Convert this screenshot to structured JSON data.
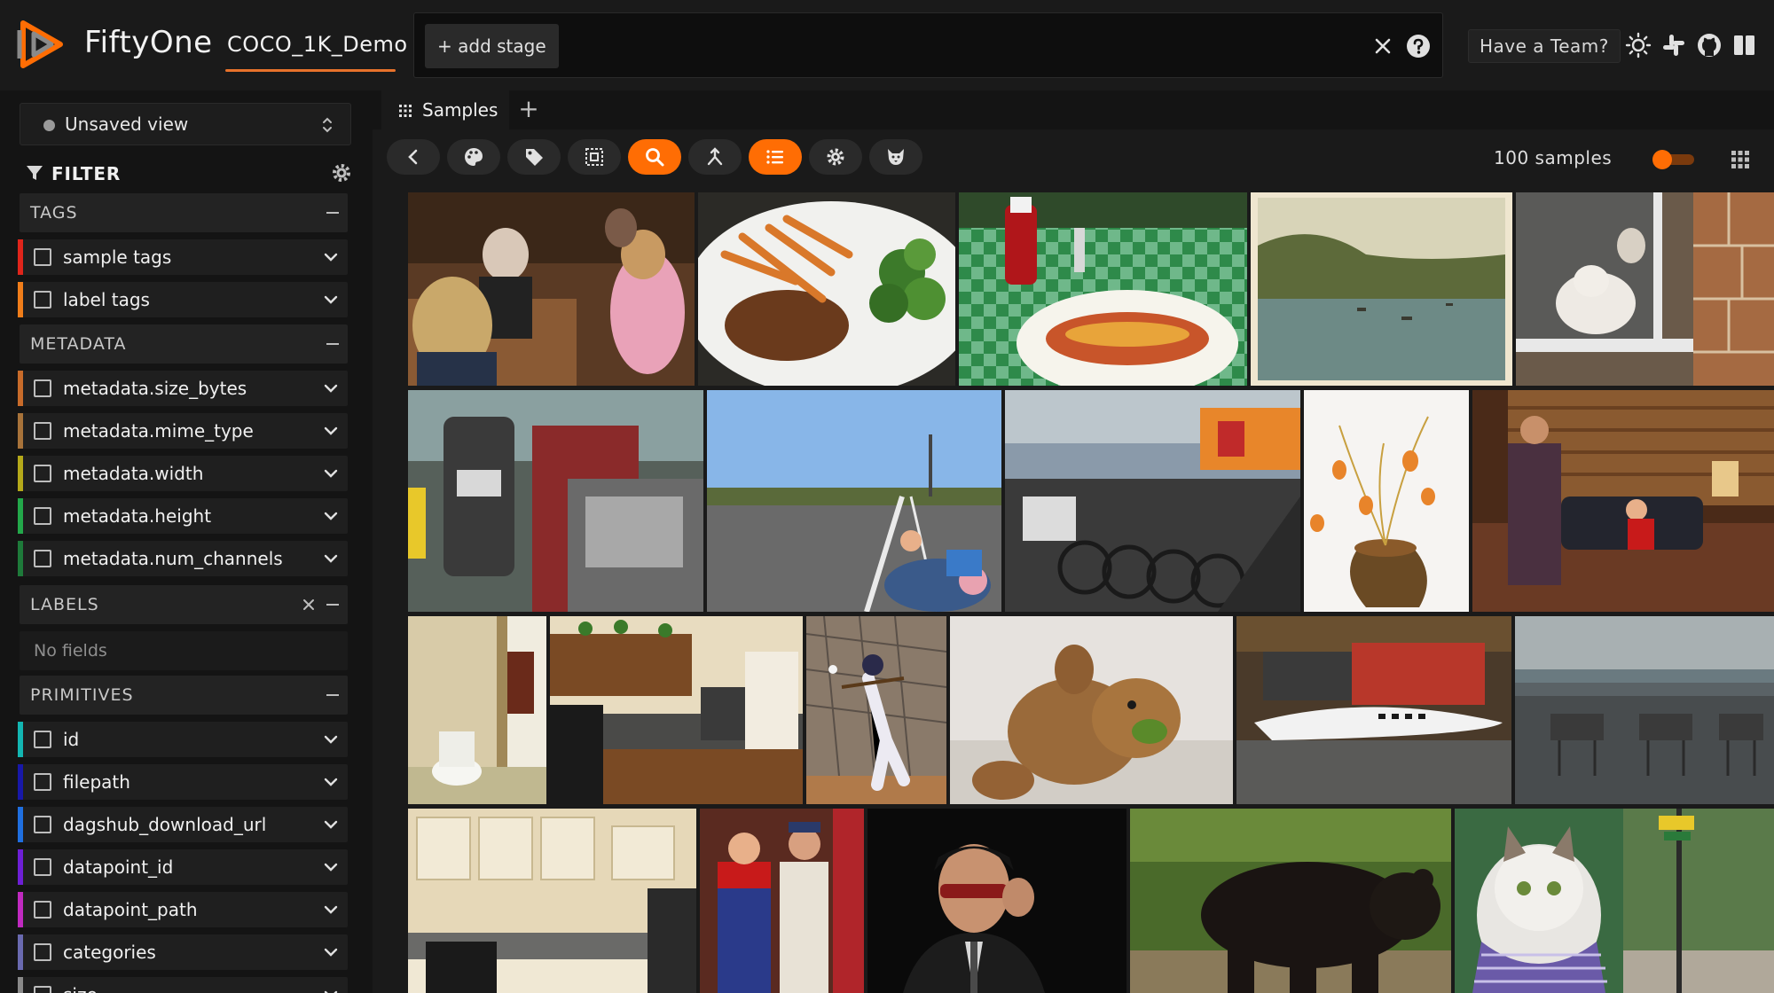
{
  "app": {
    "title": "FiftyOne",
    "dataset": "COCO_1K_Demo"
  },
  "viewbar": {
    "add_stage": "+ add stage"
  },
  "header": {
    "team_button": "Have a Team?",
    "icons": [
      "sun-icon",
      "slack-icon",
      "github-icon",
      "docs-book-icon"
    ]
  },
  "sidebar": {
    "view_selector": "Unsaved view",
    "filter_title": "FILTER",
    "sections": {
      "tags": {
        "title": "TAGS",
        "rows": [
          {
            "label": "sample tags",
            "color": "#e0251b"
          },
          {
            "label": "label tags",
            "color": "#f07d1a"
          }
        ]
      },
      "metadata": {
        "title": "METADATA",
        "rows": [
          {
            "label": "metadata.size_bytes",
            "color": "#c86b2a"
          },
          {
            "label": "metadata.mime_type",
            "color": "#a8733a"
          },
          {
            "label": "metadata.width",
            "color": "#b5a91a"
          },
          {
            "label": "metadata.height",
            "color": "#23a84a"
          },
          {
            "label": "metadata.num_channels",
            "color": "#1e7a3a"
          }
        ]
      },
      "labels": {
        "title": "LABELS",
        "empty": "No fields"
      },
      "primitives": {
        "title": "PRIMITIVES",
        "rows": [
          {
            "label": "id",
            "color": "#13b6b2"
          },
          {
            "label": "filepath",
            "color": "#1818a8"
          },
          {
            "label": "dagshub_download_url",
            "color": "#1f6fe0"
          },
          {
            "label": "datapoint_id",
            "color": "#6e1fd6"
          },
          {
            "label": "datapoint_path",
            "color": "#c02ac0"
          },
          {
            "label": "categories",
            "color": "#6a6ab0"
          },
          {
            "label": "size",
            "color": "#8a8a8a"
          }
        ]
      }
    }
  },
  "main": {
    "tab_label": "Samples",
    "sample_count": "100 samples",
    "toolbar": [
      "back-icon",
      "palette-icon",
      "tag-icon",
      "select-box-icon",
      "search-icon",
      "split-icon",
      "list-icon",
      "gear-icon",
      "dog-icon"
    ],
    "accent": "#ff6d04"
  }
}
